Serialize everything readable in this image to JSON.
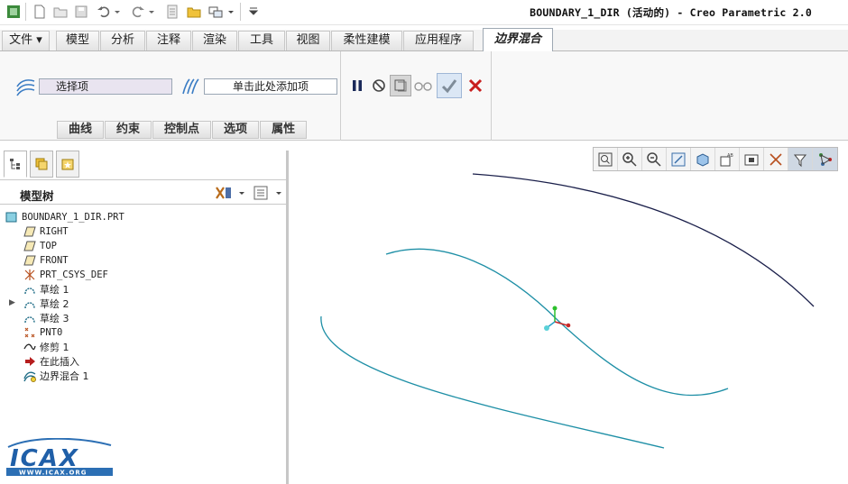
{
  "app": {
    "title": "BOUNDARY_1_DIR (活动的) - Creo Parametric 2.0"
  },
  "menu": {
    "tabs": [
      {
        "label": "文件 ▾"
      },
      {
        "label": "模型"
      },
      {
        "label": "分析"
      },
      {
        "label": "注释"
      },
      {
        "label": "渲染"
      },
      {
        "label": "工具"
      },
      {
        "label": "视图"
      },
      {
        "label": "柔性建模"
      },
      {
        "label": "应用程序"
      },
      {
        "label": "边界混合"
      }
    ]
  },
  "ribbon": {
    "first_direction_placeholder": "选择项",
    "second_direction_placeholder": "单击此处添加项",
    "subtabs": [
      {
        "label": "曲线"
      },
      {
        "label": "约束"
      },
      {
        "label": "控制点"
      },
      {
        "label": "选项"
      },
      {
        "label": "属性"
      }
    ]
  },
  "tree": {
    "title": "模型树",
    "items": [
      {
        "label": "BOUNDARY_1_DIR.PRT",
        "icon": "part-icon"
      },
      {
        "label": "RIGHT",
        "icon": "datum-plane-icon"
      },
      {
        "label": "TOP",
        "icon": "datum-plane-icon"
      },
      {
        "label": "FRONT",
        "icon": "datum-plane-icon"
      },
      {
        "label": "PRT_CSYS_DEF",
        "icon": "csys-icon"
      },
      {
        "label": "草绘 1",
        "icon": "sketch-icon"
      },
      {
        "label": "草绘 2",
        "icon": "sketch-icon"
      },
      {
        "label": "草绘 3",
        "icon": "sketch-icon"
      },
      {
        "label": "PNT0",
        "icon": "datum-point-icon"
      },
      {
        "label": "修剪 1",
        "icon": "trim-icon"
      },
      {
        "label": "在此插入",
        "icon": "insert-arrow-icon"
      },
      {
        "label": "边界混合 1",
        "icon": "boundary-blend-icon"
      }
    ]
  },
  "logo": {
    "text": "ICAX",
    "url_text": "WWW.ICAX.ORG"
  },
  "colors": {
    "curve": "#1e8fa6",
    "curve_dark": "#1a1f4a",
    "accent": "#3a7cc4",
    "confirm": "#3b8fd9",
    "cancel": "#c81e1e"
  }
}
